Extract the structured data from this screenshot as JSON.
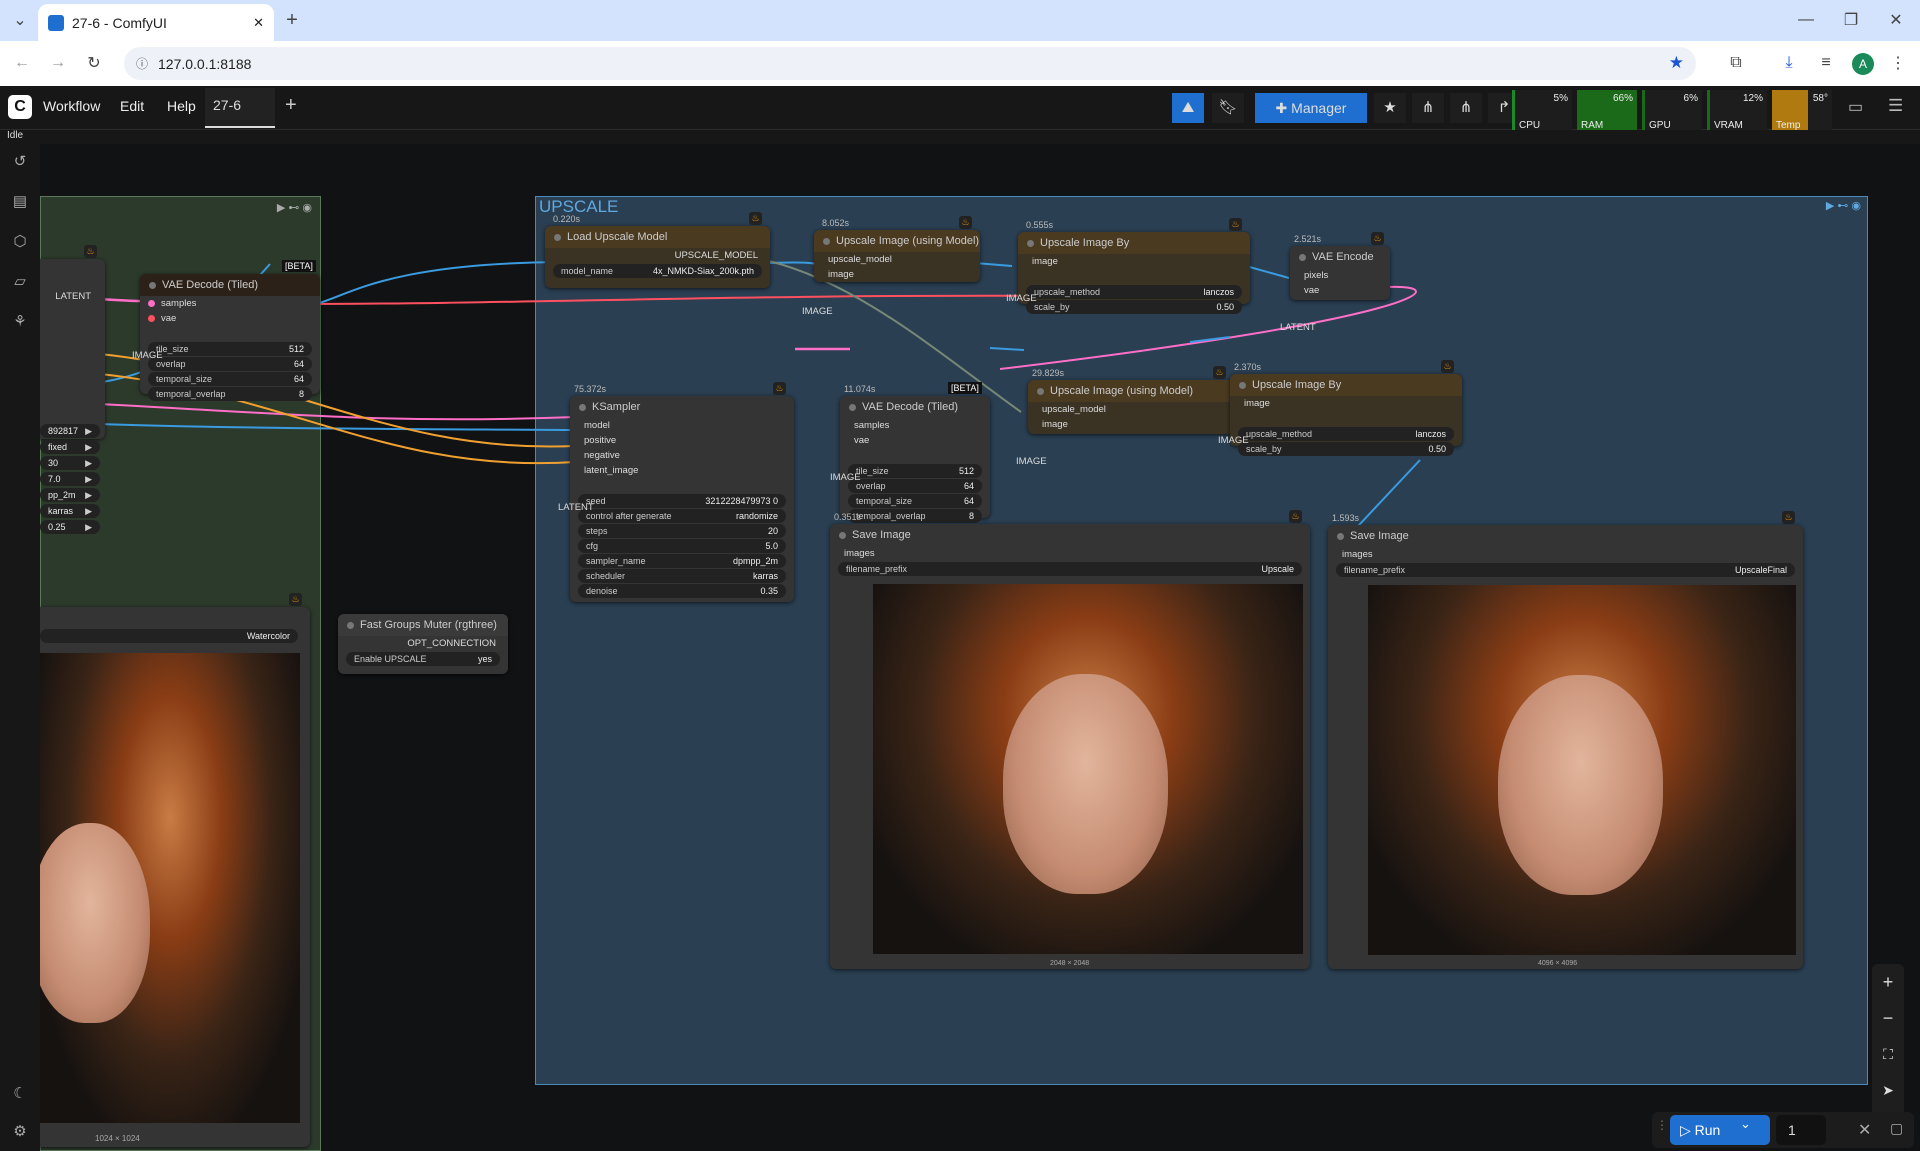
{
  "browser": {
    "tab_title": "27-6 - ComfyUI",
    "url": "127.0.0.1:8188",
    "new_tab": "+",
    "profile": "A"
  },
  "menu": {
    "workflow": "Workflow",
    "edit": "Edit",
    "help": "Help",
    "tab": "27-6",
    "add": "+"
  },
  "toolbar": {
    "manager": "Manager"
  },
  "stats": {
    "cpu_label": "CPU",
    "cpu": "5%",
    "ram_label": "RAM",
    "ram": "66%",
    "gpu_label": "GPU",
    "gpu": "6%",
    "vram_label": "VRAM",
    "vram": "12%",
    "temp_label": "Temp",
    "temp": "58°"
  },
  "status": "Idle",
  "group_upscale": {
    "title": "UPSCALE"
  },
  "nodes": {
    "vae_decode_left": {
      "title": "VAE Decode (Tiled)",
      "beta": "[BETA]",
      "in1": "samples",
      "in2": "vae",
      "out": "IMAGE",
      "latent": "LATENT",
      "w1": "tile_size",
      "v1": "512",
      "w2": "overlap",
      "v2": "64",
      "w3": "temporal_size",
      "v3": "64",
      "w4": "temporal_overlap",
      "v4": "8"
    },
    "left_widgets": [
      "892817",
      "fixed",
      "30",
      "7.0",
      "pp_2m",
      "karras",
      "0.25"
    ],
    "left_watercolor": "Watercolor",
    "left_size": "1024 × 1024",
    "fast_muter": {
      "title": "Fast Groups Muter (rgthree)",
      "out": "OPT_CONNECTION",
      "toggle_label": "Enable UPSCALE",
      "toggle_val": "yes"
    },
    "load_upscale": {
      "time": "0.220s",
      "title": "Load Upscale Model",
      "out": "UPSCALE_MODEL",
      "w": "model_name",
      "v": "4x_NMKD-Siax_200k.pth"
    },
    "upscale_model1": {
      "time": "8.052s",
      "title": "Upscale Image (using Model)",
      "in1": "upscale_model",
      "in2": "image",
      "out": "IMAGE"
    },
    "upscale_by1": {
      "time": "0.555s",
      "title": "Upscale Image By",
      "in": "image",
      "out": "IMAGE",
      "w1": "upscale_method",
      "v1": "lanczos",
      "w2": "scale_by",
      "v2": "0.50"
    },
    "vae_encode": {
      "time": "2.521s",
      "title": "VAE Encode",
      "in1": "pixels",
      "in2": "vae",
      "out": "LATENT"
    },
    "ksampler": {
      "time": "75.372s",
      "title": "KSampler",
      "in": [
        "model",
        "positive",
        "negative",
        "latent_image"
      ],
      "out": "LATENT",
      "widgets": [
        [
          "seed",
          "3212228479973 0"
        ],
        [
          "control after generate",
          "randomize"
        ],
        [
          "steps",
          "20"
        ],
        [
          "cfg",
          "5.0"
        ],
        [
          "sampler_name",
          "dpmpp_2m"
        ],
        [
          "scheduler",
          "karras"
        ],
        [
          "denoise",
          "0.35"
        ]
      ]
    },
    "vae_decode_mid": {
      "time": "11.074s",
      "title": "VAE Decode (Tiled)",
      "beta": "[BETA]",
      "in1": "samples",
      "in2": "vae",
      "out": "IMAGE",
      "w1": "tile_size",
      "v1": "512",
      "w2": "overlap",
      "v2": "64",
      "w3": "temporal_size",
      "v3": "64",
      "w4": "temporal_overlap",
      "v4": "8"
    },
    "upscale_model2": {
      "time": "29.829s",
      "title": "Upscale Image (using Model)",
      "in1": "upscale_model",
      "in2": "image",
      "out": "IMAGE"
    },
    "upscale_by2": {
      "time": "2.370s",
      "title": "Upscale Image By",
      "in": "image",
      "out": "IMAGE",
      "w1": "upscale_method",
      "v1": "lanczos",
      "w2": "scale_by",
      "v2": "0.50"
    },
    "save1": {
      "time": "0.351s",
      "title": "Save Image",
      "in": "images",
      "w": "filename_prefix",
      "v": "Upscale",
      "size": "2048 × 2048"
    },
    "save2": {
      "time": "1.593s",
      "title": "Save Image",
      "in": "images",
      "w": "filename_prefix",
      "v": "UpscaleFinal",
      "size": "4096 × 4096"
    }
  },
  "run": {
    "label": "Run",
    "count": "1"
  },
  "colors": {
    "accent": "#1e6fd0",
    "group_border": "#4a8ab8",
    "link_pink": "#ff6ec7",
    "link_blue": "#3a9be0",
    "link_orange": "#f0a030",
    "link_red": "#ff5060"
  }
}
